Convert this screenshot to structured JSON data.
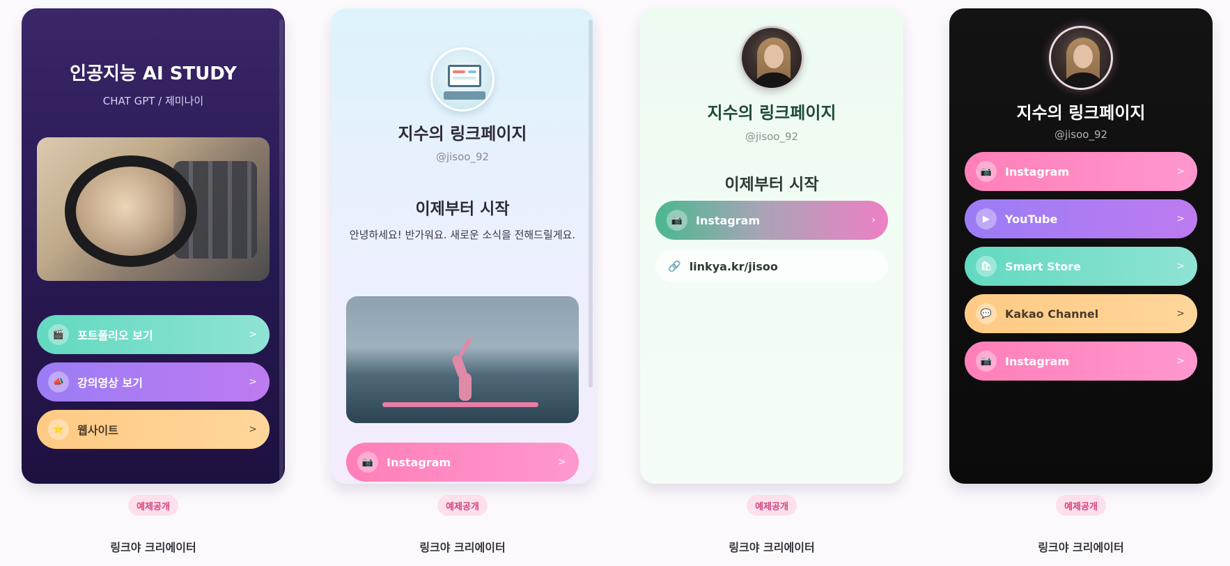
{
  "cards": [
    {
      "title": "인공지능 AI STUDY",
      "subtitle": "CHAT GPT / 제미나이",
      "links": [
        {
          "label": "포트폴리오 보기",
          "icon": "clapperboard-icon",
          "arrow": ">"
        },
        {
          "label": "강의영상 보기",
          "icon": "megaphone-icon",
          "arrow": ">"
        },
        {
          "label": "웹사이트",
          "icon": "star-icon",
          "arrow": ">"
        }
      ],
      "badge": "예제공개",
      "creator": "링크야 크리에이터"
    },
    {
      "title": "지수의 링크페이지",
      "handle": "@jisoo_92",
      "section_title": "이제부터 시작",
      "description": "안녕하세요! 반가워요. 새로운 소식을 전해드릴게요.",
      "links": [
        {
          "label": "Instagram",
          "icon": "camera-icon",
          "arrow": ">"
        }
      ],
      "badge": "예제공개",
      "creator": "링크야 크리에이터"
    },
    {
      "title": "지수의 링크페이지",
      "handle": "@jisoo_92",
      "section_title": "이제부터 시작",
      "links": [
        {
          "label": "Instagram",
          "icon": "camera-icon",
          "arrow": "›"
        }
      ],
      "link_url": "linkya.kr/jisoo",
      "badge": "예제공개",
      "creator": "링크야 크리에이터"
    },
    {
      "title": "지수의 링크페이지",
      "handle": "@jisoo_92",
      "links": [
        {
          "label": "Instagram",
          "icon": "camera-icon",
          "arrow": ">"
        },
        {
          "label": "YouTube",
          "icon": "play-icon",
          "arrow": ">"
        },
        {
          "label": "Smart Store",
          "icon": "shopping-bag-icon",
          "arrow": ">"
        },
        {
          "label": "Kakao Channel",
          "icon": "speech-bubble-icon",
          "arrow": ">"
        },
        {
          "label": "Instagram",
          "icon": "camera-icon",
          "arrow": ">"
        }
      ],
      "badge": "예제공개",
      "creator": "링크야 크리에이터"
    }
  ],
  "colors": {
    "teal": "#62d9c0",
    "purple": "#9b7cf5",
    "orange": "#ffca84",
    "pink": "#ff7fb8",
    "badge_bg": "#fde0ec",
    "badge_text": "#d4427f"
  }
}
